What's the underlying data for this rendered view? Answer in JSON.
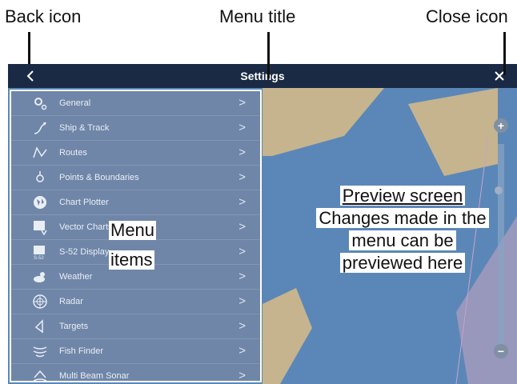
{
  "callouts": {
    "back_icon": "Back icon",
    "menu_title": "Menu title",
    "close_icon": "Close icon"
  },
  "titlebar": {
    "title": "Settings"
  },
  "menu": {
    "items": [
      {
        "label": "General",
        "icon": "gear-icon"
      },
      {
        "label": "Ship & Track",
        "icon": "ship-track-icon"
      },
      {
        "label": "Routes",
        "icon": "routes-icon"
      },
      {
        "label": "Points & Boundaries",
        "icon": "points-icon"
      },
      {
        "label": "Chart Plotter",
        "icon": "chart-plotter-icon"
      },
      {
        "label": "Vector Charts",
        "icon": "vector-chart-icon"
      },
      {
        "label": "S-52 Display",
        "icon": "s52-icon"
      },
      {
        "label": "Weather",
        "icon": "weather-icon"
      },
      {
        "label": "Radar",
        "icon": "radar-icon"
      },
      {
        "label": "Targets",
        "icon": "targets-icon"
      },
      {
        "label": "Fish Finder",
        "icon": "fish-finder-icon"
      },
      {
        "label": "Multi Beam Sonar",
        "icon": "sonar-icon"
      }
    ],
    "chevron": ">"
  },
  "annotations": {
    "menu_items_line1": "Menu",
    "menu_items_line2": "items",
    "preview_line1": "Preview screen",
    "preview_line2": "Changes made in the",
    "preview_line3": "menu can be",
    "preview_line4": "previewed here"
  },
  "map": {
    "zoom_in": "+",
    "zoom_out": "−",
    "colors": {
      "water": "#5b87b8",
      "land": "#c5b48e",
      "panel": "#6f86a8",
      "titlebar": "#1a2a44"
    }
  }
}
